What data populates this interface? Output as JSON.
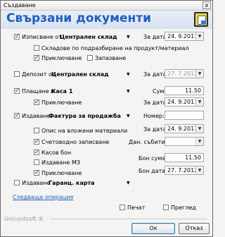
{
  "window": {
    "title": "Създаване",
    "close_glyph": "x"
  },
  "header": {
    "title": "Свързани документи",
    "icon": "documents-icon"
  },
  "rows": {
    "issue": {
      "label": "Изписване от",
      "warehouse": "Централен склад",
      "checked": true
    },
    "default_wh": {
      "label": "Складове по подразбиране на продукт/материал",
      "checked": false
    },
    "post1": {
      "label": "Приключване",
      "checked": true
    },
    "reserve": {
      "label": "Запазване",
      "checked": false
    },
    "deposit": {
      "label": "Депозит от",
      "warehouse": "Централен склад",
      "checked": false
    },
    "payment": {
      "label": "Плащане в",
      "cashbox": "Каса 1",
      "checked": true
    },
    "post2": {
      "label": "Приключване",
      "checked": true
    },
    "invoice": {
      "label": "Издаване",
      "doc": "Фактура за продажба",
      "checked": true
    },
    "inventory": {
      "label": "Опис на вложени материали",
      "checked": false
    },
    "accounting": {
      "label": "Счетоводно записване",
      "checked": true
    },
    "cash_receipt": {
      "label": "Касов бон",
      "checked": true
    },
    "mz": {
      "label": "Издаване МЗ",
      "checked": false
    },
    "post3": {
      "label": "Приключване",
      "checked": true
    },
    "warranty": {
      "label": "Издаване",
      "doc": "Гаранц. карта",
      "checked": false
    }
  },
  "right": {
    "date_label": "За дата:",
    "date1": "24. 9.2011",
    "date2": "27. 7.2012",
    "sum_label": "Сума:",
    "sum": "11.50",
    "date3": "24. 9.2011",
    "number_label": "Номер:",
    "number": "",
    "date4": "24. 9.2011",
    "tax_label": "Дан. събитие:",
    "tax_value": "",
    "receipt_sum_label": "Бон сума:",
    "receipt_sum": "11.50",
    "receipt_date_label": "Бон дата:",
    "receipt_date": "27. 7.2012"
  },
  "footer": {
    "next_op": "Следваща операция",
    "brand": "Unicontsoft ®",
    "print": "Печат",
    "preview": "Преглед",
    "ok": "Ок",
    "cancel": "Отказ"
  }
}
